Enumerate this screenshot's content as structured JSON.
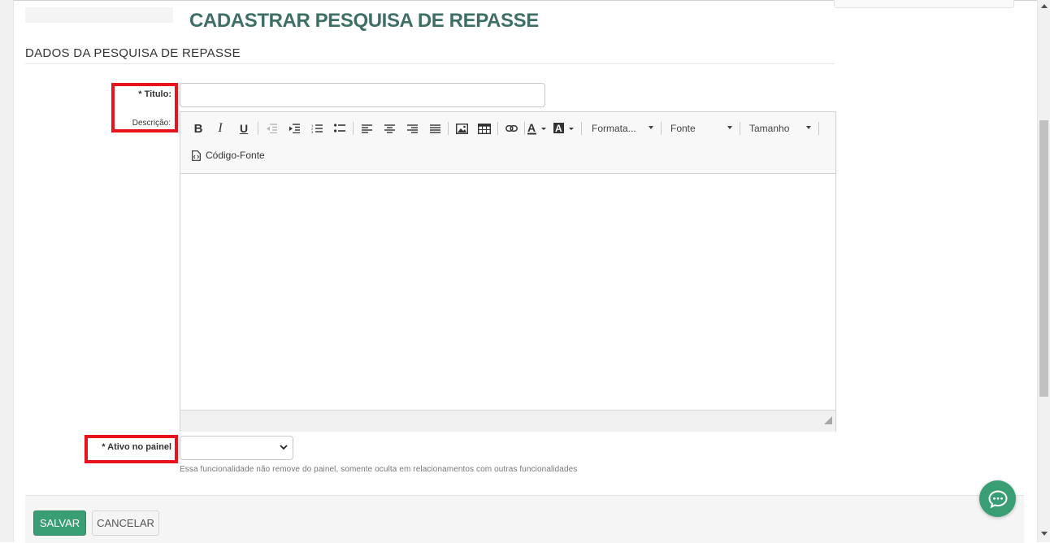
{
  "page": {
    "title": "CADASTRAR PESQUISA DE REPASSE",
    "section_title": "DADOS DA PESQUISA DE REPASSE"
  },
  "form": {
    "titulo_label": "* Titulo:",
    "titulo_value": "",
    "descricao_label": "Descrição:",
    "ativo_label": "* Ativo no painel",
    "ativo_selected": "",
    "ativo_help": "Essa funcionalidade não remove do painel, somente oculta em relacionamentos com outras funcionalidades"
  },
  "editor": {
    "bold": "B",
    "italic": "I",
    "underline": "U",
    "format_label": "Formata...",
    "font_label": "Fonte",
    "size_label": "Tamanho",
    "source_label": "Código-Fonte",
    "content": ""
  },
  "actions": {
    "save_label": "SALVAR",
    "cancel_label": "CANCELAR"
  },
  "colors": {
    "accent": "#3a9e75",
    "title": "#3d6f66",
    "highlight": "#e8131b"
  }
}
